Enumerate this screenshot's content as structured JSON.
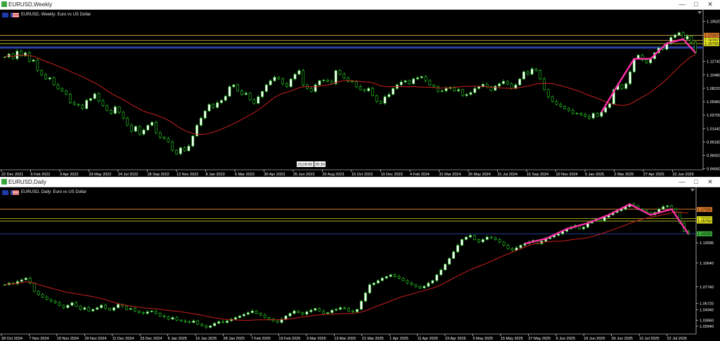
{
  "colors": {
    "bg": "#000000",
    "bull": "#ffffff",
    "bear": "#ffffff",
    "wick": "#22cc22",
    "ma": "#cc1f1f",
    "hl_gold": "#c7a53c",
    "hl_yellow": "#cccc22",
    "hl_blue": "#2a3fa0",
    "hl_orange": "#d8792a",
    "overlay": "#ff2fa8",
    "axis": "#ffffff"
  },
  "windows": [
    {
      "title": "EURUSD,Weekly",
      "header_text": "EURUSD, Weekly: Euro vs US Dollar",
      "buttons": {
        "minimize": "—",
        "maximize": "□",
        "close": "✕"
      },
      "price_ticks": [
        "1.19520",
        "1.17157",
        "1.16297",
        "1.15750",
        "1.12740",
        "1.10480",
        "1.08220",
        "1.05960",
        "1.03700",
        "1.01440",
        "0.99180",
        "0.96920",
        "0.94660"
      ],
      "date_ticks": [
        "22 Dec 2021",
        "6 Feb 2022",
        "3 Apr 2022",
        "29 May 2022",
        "24 Jul 2022",
        "18 Sep 2022",
        "13 Nov 2022",
        "8 Jan 2023",
        "5 Mar 2023",
        "30 Apr 2023",
        "25 Jun 2023",
        "20 Aug 2023",
        "15 Oct 2023",
        "10 Dec 2023",
        "4 Feb 2024",
        "31 Mar 2024",
        "26 May 2024",
        "21 Jul 2024",
        "15 Sep 2024",
        "10 Nov 2024",
        "5 Jan 2025",
        "2 Mar 2025",
        "27 Apr 2025",
        "22 Jun 2025"
      ],
      "crosshair_labels": [
        "21|18:00",
        "20:30"
      ],
      "price_tags": [
        {
          "text": "1.17157",
          "color": "#d8792a"
        },
        {
          "text": "1.16297",
          "color": "#e0e020"
        },
        {
          "text": "1.15750",
          "color": "#e0e020"
        }
      ],
      "chart_data": {
        "type": "candlestick",
        "symbol": "EURUSD",
        "timeframe": "Weekly",
        "ylim": [
          0.945,
          1.205
        ],
        "closes": [
          1.135,
          1.14,
          1.132,
          1.145,
          1.137,
          1.142,
          1.128,
          1.13,
          1.112,
          1.105,
          1.098,
          1.1,
          1.088,
          1.082,
          1.078,
          1.072,
          1.058,
          1.055,
          1.054,
          1.048,
          1.062,
          1.065,
          1.073,
          1.061,
          1.053,
          1.045,
          1.04,
          1.051,
          1.042,
          1.032,
          1.02,
          1.01,
          1.018,
          1.005,
          1.012,
          1.02,
          1.025,
          1.007,
          1.0,
          0.998,
          0.992,
          0.978,
          0.972,
          0.982,
          0.977,
          0.985,
          1.002,
          1.02,
          1.032,
          1.044,
          1.055,
          1.05,
          1.058,
          1.062,
          1.069,
          1.085,
          1.088,
          1.078,
          1.072,
          1.074,
          1.063,
          1.057,
          1.068,
          1.077,
          1.088,
          1.095,
          1.101,
          1.098,
          1.09,
          1.085,
          1.098,
          1.106,
          1.112,
          1.088,
          1.082,
          1.077,
          1.088,
          1.095,
          1.096,
          1.094,
          1.09,
          1.112,
          1.106,
          1.1,
          1.094,
          1.093,
          1.085,
          1.08,
          1.078,
          1.082,
          1.07,
          1.06,
          1.057,
          1.068,
          1.072,
          1.082,
          1.088,
          1.093,
          1.095,
          1.09,
          1.098,
          1.1,
          1.102,
          1.095,
          1.088,
          1.085,
          1.077,
          1.078,
          1.082,
          1.084,
          1.078,
          1.08,
          1.07,
          1.072,
          1.075,
          1.082,
          1.085,
          1.089,
          1.085,
          1.079,
          1.086,
          1.09,
          1.094,
          1.09,
          1.082,
          1.088,
          1.098,
          1.11,
          1.106,
          1.115,
          1.112,
          1.098,
          1.08,
          1.068,
          1.06,
          1.055,
          1.052,
          1.048,
          1.045,
          1.04,
          1.04,
          1.038,
          1.035,
          1.032,
          1.04,
          1.035,
          1.042,
          1.05,
          1.056,
          1.08,
          1.088,
          1.082,
          1.09,
          1.11,
          1.132,
          1.138,
          1.13,
          1.125,
          1.132,
          1.142,
          1.15,
          1.148,
          1.158,
          1.168,
          1.172,
          1.176,
          1.165,
          1.17,
          1.16,
          1.142
        ],
        "ma_label": "MA"
      }
    },
    {
      "title": "EURUSD,Daily",
      "header_text": "EURUSD, Daily: Euro vs US Dollar",
      "buttons": {
        "minimize": "—",
        "maximize": "□",
        "close": "✕"
      },
      "price_ticks": [
        "1.17155",
        "1.16040",
        "1.15750",
        "1.13096",
        "1.10640",
        "1.07740",
        "1.05720",
        "1.04940",
        "1.03660",
        "1.02940"
      ],
      "date_ticks": [
        "28 Oct 2024",
        "7 Nov 2024",
        "19 Nov 2024",
        "29 Nov 2024",
        "11 Dec 2024",
        "23 Dec 2024",
        "6 Jan 2025",
        "16 Jan 2025",
        "28 Jan 2025",
        "7 Feb 2025",
        "19 Feb 2025",
        "3 Mar 2025",
        "13 Mar 2025",
        "21 Mar 2025",
        "1 Apr 2025",
        "11 Apr 2025",
        "23 Apr 2025",
        "5 May 2025",
        "15 May 2025",
        "27 May 2025",
        "6 Jun 2025",
        "18 Jun 2025",
        "30 Jun 2025",
        "10 Jul 2025",
        "22 Jul 2025"
      ],
      "price_tags": [
        {
          "text": "1.17155",
          "color": "#d8792a"
        },
        {
          "text": "1.16040",
          "color": "#e0e020"
        },
        {
          "text": "1.15750",
          "color": "#e0e020"
        },
        {
          "text": "1.14200",
          "color": "#3db23d"
        }
      ],
      "chart_data": {
        "type": "candlestick",
        "symbol": "EURUSD",
        "timeframe": "Daily",
        "ylim": [
          1.02,
          1.19
        ],
        "closes": [
          1.08,
          1.082,
          1.081,
          1.084,
          1.086,
          1.088,
          1.082,
          1.072,
          1.068,
          1.065,
          1.062,
          1.06,
          1.058,
          1.055,
          1.052,
          1.055,
          1.058,
          1.054,
          1.05,
          1.052,
          1.048,
          1.05,
          1.052,
          1.055,
          1.051,
          1.049,
          1.052,
          1.056,
          1.054,
          1.05,
          1.051,
          1.048,
          1.046,
          1.045,
          1.047,
          1.048,
          1.045,
          1.042,
          1.041,
          1.038,
          1.04,
          1.037,
          1.036,
          1.035,
          1.034,
          1.036,
          1.032,
          1.03,
          1.028,
          1.03,
          1.033,
          1.035,
          1.034,
          1.036,
          1.038,
          1.04,
          1.042,
          1.044,
          1.046,
          1.048,
          1.045,
          1.043,
          1.04,
          1.038,
          1.036,
          1.034,
          1.038,
          1.042,
          1.045,
          1.048,
          1.046,
          1.044,
          1.047,
          1.049,
          1.051,
          1.048,
          1.045,
          1.046,
          1.049,
          1.05,
          1.052,
          1.051,
          1.048,
          1.047,
          1.05,
          1.06,
          1.07,
          1.08,
          1.082,
          1.085,
          1.088,
          1.09,
          1.092,
          1.09,
          1.088,
          1.085,
          1.082,
          1.08,
          1.078,
          1.076,
          1.078,
          1.082,
          1.085,
          1.092,
          1.098,
          1.105,
          1.112,
          1.12,
          1.128,
          1.135,
          1.138,
          1.14,
          1.135,
          1.132,
          1.135,
          1.138,
          1.137,
          1.135,
          1.132,
          1.128,
          1.124,
          1.122,
          1.125,
          1.128,
          1.13,
          1.132,
          1.134,
          1.13,
          1.133,
          1.136,
          1.138,
          1.14,
          1.142,
          1.145,
          1.148,
          1.15,
          1.152,
          1.148,
          1.15,
          1.155,
          1.158,
          1.16,
          1.158,
          1.162,
          1.165,
          1.168,
          1.17,
          1.172,
          1.175,
          1.178,
          1.176,
          1.172,
          1.17,
          1.168,
          1.165,
          1.168,
          1.172,
          1.175,
          1.176,
          1.172,
          1.168,
          1.155,
          1.145,
          1.142
        ],
        "ma_label": "MA"
      }
    }
  ]
}
